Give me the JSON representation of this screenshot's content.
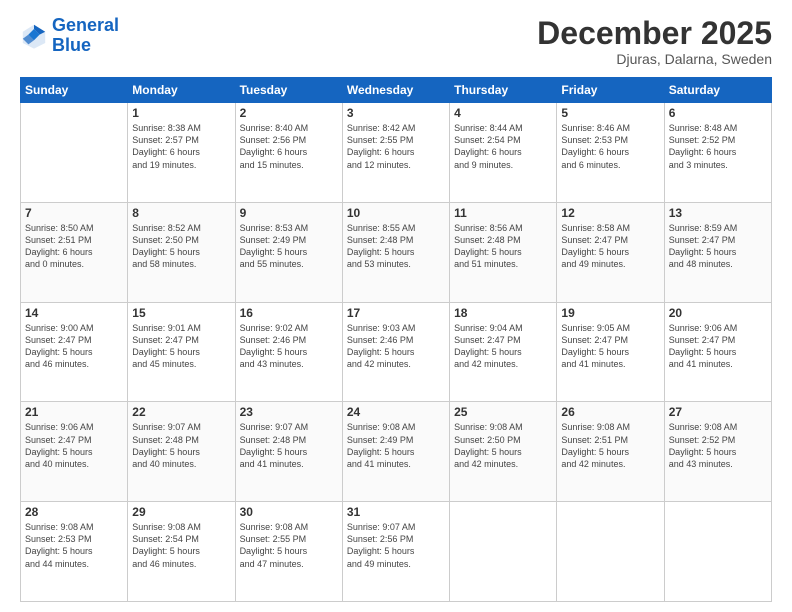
{
  "logo": {
    "line1": "General",
    "line2": "Blue"
  },
  "title": "December 2025",
  "subtitle": "Djuras, Dalarna, Sweden",
  "weekdays": [
    "Sunday",
    "Monday",
    "Tuesday",
    "Wednesday",
    "Thursday",
    "Friday",
    "Saturday"
  ],
  "weeks": [
    [
      {
        "day": "",
        "info": ""
      },
      {
        "day": "1",
        "info": "Sunrise: 8:38 AM\nSunset: 2:57 PM\nDaylight: 6 hours\nand 19 minutes."
      },
      {
        "day": "2",
        "info": "Sunrise: 8:40 AM\nSunset: 2:56 PM\nDaylight: 6 hours\nand 15 minutes."
      },
      {
        "day": "3",
        "info": "Sunrise: 8:42 AM\nSunset: 2:55 PM\nDaylight: 6 hours\nand 12 minutes."
      },
      {
        "day": "4",
        "info": "Sunrise: 8:44 AM\nSunset: 2:54 PM\nDaylight: 6 hours\nand 9 minutes."
      },
      {
        "day": "5",
        "info": "Sunrise: 8:46 AM\nSunset: 2:53 PM\nDaylight: 6 hours\nand 6 minutes."
      },
      {
        "day": "6",
        "info": "Sunrise: 8:48 AM\nSunset: 2:52 PM\nDaylight: 6 hours\nand 3 minutes."
      }
    ],
    [
      {
        "day": "7",
        "info": "Sunrise: 8:50 AM\nSunset: 2:51 PM\nDaylight: 6 hours\nand 0 minutes."
      },
      {
        "day": "8",
        "info": "Sunrise: 8:52 AM\nSunset: 2:50 PM\nDaylight: 5 hours\nand 58 minutes."
      },
      {
        "day": "9",
        "info": "Sunrise: 8:53 AM\nSunset: 2:49 PM\nDaylight: 5 hours\nand 55 minutes."
      },
      {
        "day": "10",
        "info": "Sunrise: 8:55 AM\nSunset: 2:48 PM\nDaylight: 5 hours\nand 53 minutes."
      },
      {
        "day": "11",
        "info": "Sunrise: 8:56 AM\nSunset: 2:48 PM\nDaylight: 5 hours\nand 51 minutes."
      },
      {
        "day": "12",
        "info": "Sunrise: 8:58 AM\nSunset: 2:47 PM\nDaylight: 5 hours\nand 49 minutes."
      },
      {
        "day": "13",
        "info": "Sunrise: 8:59 AM\nSunset: 2:47 PM\nDaylight: 5 hours\nand 48 minutes."
      }
    ],
    [
      {
        "day": "14",
        "info": "Sunrise: 9:00 AM\nSunset: 2:47 PM\nDaylight: 5 hours\nand 46 minutes."
      },
      {
        "day": "15",
        "info": "Sunrise: 9:01 AM\nSunset: 2:47 PM\nDaylight: 5 hours\nand 45 minutes."
      },
      {
        "day": "16",
        "info": "Sunrise: 9:02 AM\nSunset: 2:46 PM\nDaylight: 5 hours\nand 43 minutes."
      },
      {
        "day": "17",
        "info": "Sunrise: 9:03 AM\nSunset: 2:46 PM\nDaylight: 5 hours\nand 42 minutes."
      },
      {
        "day": "18",
        "info": "Sunrise: 9:04 AM\nSunset: 2:47 PM\nDaylight: 5 hours\nand 42 minutes."
      },
      {
        "day": "19",
        "info": "Sunrise: 9:05 AM\nSunset: 2:47 PM\nDaylight: 5 hours\nand 41 minutes."
      },
      {
        "day": "20",
        "info": "Sunrise: 9:06 AM\nSunset: 2:47 PM\nDaylight: 5 hours\nand 41 minutes."
      }
    ],
    [
      {
        "day": "21",
        "info": "Sunrise: 9:06 AM\nSunset: 2:47 PM\nDaylight: 5 hours\nand 40 minutes."
      },
      {
        "day": "22",
        "info": "Sunrise: 9:07 AM\nSunset: 2:48 PM\nDaylight: 5 hours\nand 40 minutes."
      },
      {
        "day": "23",
        "info": "Sunrise: 9:07 AM\nSunset: 2:48 PM\nDaylight: 5 hours\nand 41 minutes."
      },
      {
        "day": "24",
        "info": "Sunrise: 9:08 AM\nSunset: 2:49 PM\nDaylight: 5 hours\nand 41 minutes."
      },
      {
        "day": "25",
        "info": "Sunrise: 9:08 AM\nSunset: 2:50 PM\nDaylight: 5 hours\nand 42 minutes."
      },
      {
        "day": "26",
        "info": "Sunrise: 9:08 AM\nSunset: 2:51 PM\nDaylight: 5 hours\nand 42 minutes."
      },
      {
        "day": "27",
        "info": "Sunrise: 9:08 AM\nSunset: 2:52 PM\nDaylight: 5 hours\nand 43 minutes."
      }
    ],
    [
      {
        "day": "28",
        "info": "Sunrise: 9:08 AM\nSunset: 2:53 PM\nDaylight: 5 hours\nand 44 minutes."
      },
      {
        "day": "29",
        "info": "Sunrise: 9:08 AM\nSunset: 2:54 PM\nDaylight: 5 hours\nand 46 minutes."
      },
      {
        "day": "30",
        "info": "Sunrise: 9:08 AM\nSunset: 2:55 PM\nDaylight: 5 hours\nand 47 minutes."
      },
      {
        "day": "31",
        "info": "Sunrise: 9:07 AM\nSunset: 2:56 PM\nDaylight: 5 hours\nand 49 minutes."
      },
      {
        "day": "",
        "info": ""
      },
      {
        "day": "",
        "info": ""
      },
      {
        "day": "",
        "info": ""
      }
    ]
  ]
}
